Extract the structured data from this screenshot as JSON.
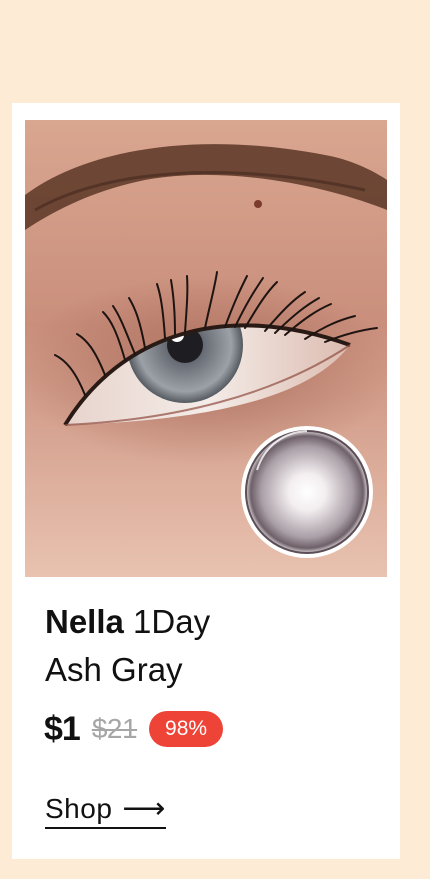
{
  "product": {
    "brand": "Nella",
    "name_line1": "1Day",
    "name_line2": "Ash Gray",
    "price": "$1",
    "old_price": "$21",
    "discount": "98%",
    "cta_label": "Shop",
    "cta_arrow": "⟶"
  },
  "colors": {
    "page_background": "#fdebd6",
    "card_background": "#ffffff",
    "discount_badge": "#ee4438",
    "old_price": "#a6a6a6"
  }
}
